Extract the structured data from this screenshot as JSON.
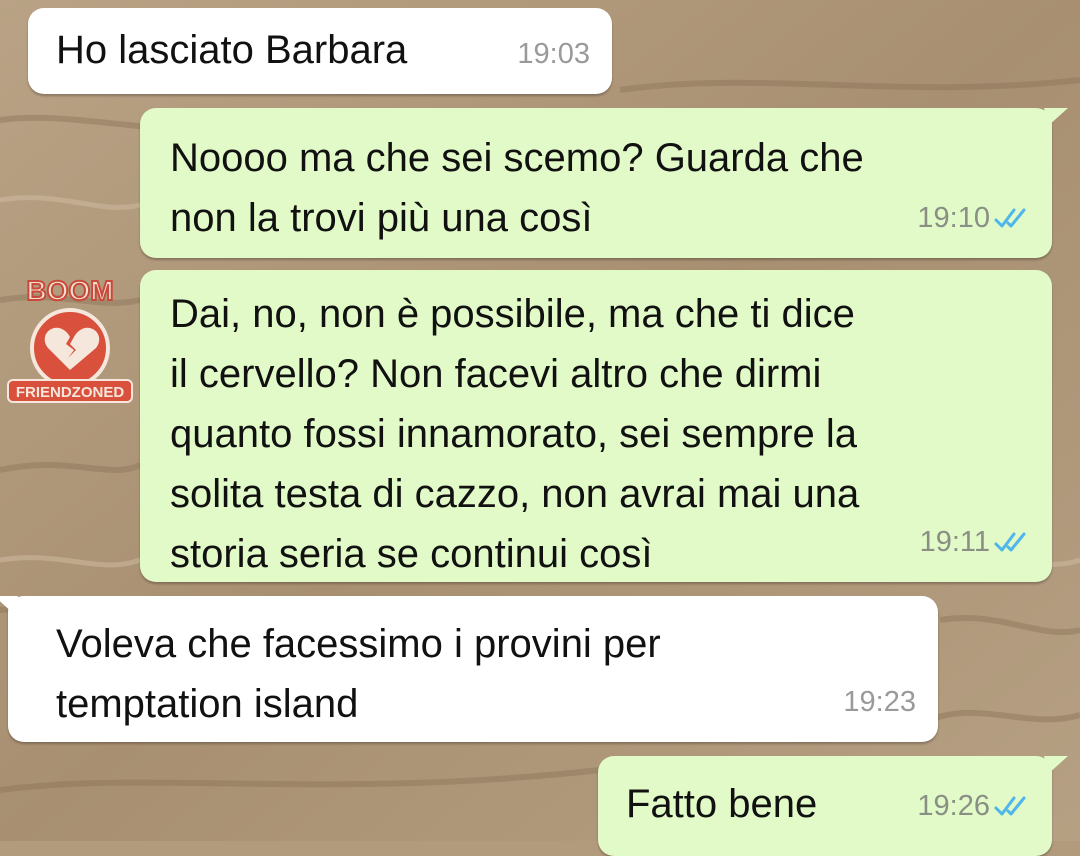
{
  "colors": {
    "incoming_bubble": "#ffffff",
    "outgoing_bubble": "#e1fac7",
    "read_ticks": "#4fb6ec",
    "timestamp": "#8a8f85",
    "wallpaper": "#b29a7c"
  },
  "watermark": {
    "top_text": "BOOM",
    "bottom_text": "FRIENDZONED",
    "icon": "broken-heart-icon"
  },
  "messages": [
    {
      "direction": "incoming",
      "text": "Ho lasciato Barbara",
      "time": "19:03"
    },
    {
      "direction": "outgoing",
      "text": "Noooo ma che sei scemo? Guarda che\nnon la trovi più una così",
      "time": "19:10",
      "status": "read"
    },
    {
      "direction": "outgoing",
      "text": "Dai, no, non è possibile, ma che ti dice\nil cervello? Non facevi altro che dirmi\nquanto fossi innamorato, sei sempre la\nsolita testa di cazzo, non avrai mai una\nstoria seria se continui così",
      "time": "19:11",
      "status": "read"
    },
    {
      "direction": "incoming",
      "text": "Voleva che facessimo i provini per\ntemptation island",
      "time": "19:23"
    },
    {
      "direction": "outgoing",
      "text": "Fatto bene",
      "time": "19:26",
      "status": "read"
    }
  ]
}
